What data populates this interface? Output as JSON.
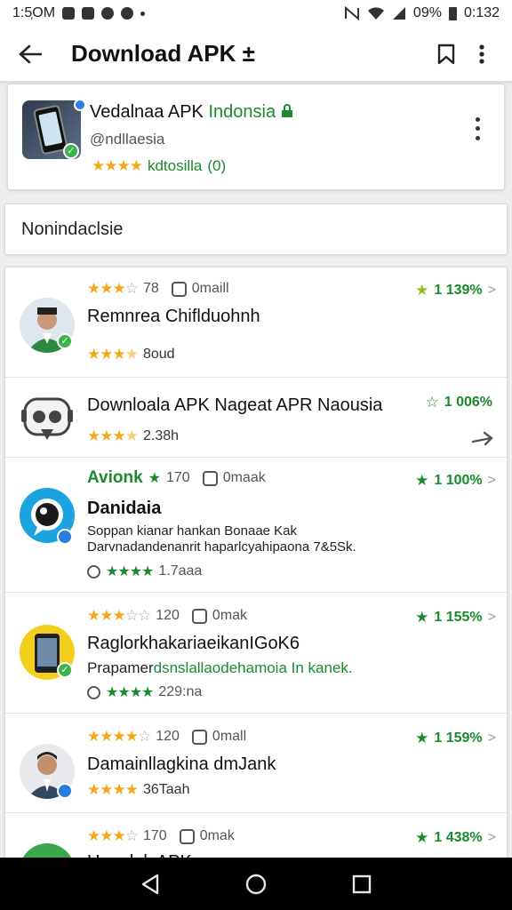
{
  "status_bar": {
    "time": "1:5᷊OM",
    "battery": "09%",
    "clock": "0:132"
  },
  "app_bar": {
    "title": "Download APK ±"
  },
  "top_card": {
    "name_main": "Vedalnaa APK ",
    "name_highlight": "Indonsia",
    "subtitle": "@ndllaesia",
    "stars": "★★★★",
    "rating_label": "kdtosilla",
    "rating_badge": "(0)"
  },
  "search": {
    "placeholder": "Nonindaclsie"
  },
  "list": [
    {
      "meta_stars": "★★★",
      "meta_empty": "☆",
      "meta_num": "78",
      "meta_label": "0maill",
      "pct": "1 139%",
      "title": "Remnrea Chiflduohnh",
      "stars": "★★★",
      "stars_empty": "★",
      "rating_text": "8oud"
    },
    {
      "title": "Downloala APK Nageat APR Naousia",
      "pct": "1 006%",
      "stars": "★★★",
      "stars_empty": "★",
      "rating_text": "2.38h"
    },
    {
      "meta_title": "Avionk",
      "meta_num": "170",
      "meta_label": "0maak",
      "pct": "1 100%",
      "title": "Danidaia",
      "desc_1": "Soppan kianar hankan Bonaae Kak",
      "desc_2": "Darvnadandenanrit haparlcyahipaona 7&5Sk.",
      "stars": "★★★★",
      "rating_text": "1.7aaa"
    },
    {
      "meta_stars": "★★★",
      "meta_empty": "☆☆",
      "meta_num": "120",
      "meta_label": "0mak",
      "pct": "1 155%",
      "title": "RaglorkhakariaeikanIGoK6",
      "desc_1_black": "Prapamer",
      "desc_1_green": "dsnslallaodehamoia In kanek.",
      "stars": "★★★★",
      "rating_text": "229:na"
    },
    {
      "meta_stars": "★★★★",
      "meta_empty": "☆",
      "meta_num": "120",
      "meta_label": "0mall",
      "pct": "1 159%",
      "title": "Damainllagkina dmJank",
      "stars": "★★★★",
      "rating_text": "36Taah"
    },
    {
      "meta_stars": "★★★",
      "meta_empty": "☆",
      "meta_num": "170",
      "meta_label": "0mak",
      "pct": "1 438%",
      "title": "Hanulak APK"
    }
  ],
  "colors": {
    "accent_green": "#1a8a2e",
    "star_gold": "#f2a81a",
    "badge_blue": "#2a7de1"
  },
  "icons": [
    "back-arrow-icon",
    "bookmark-icon",
    "more-vert-icon",
    "chevron-right-icon",
    "arrow-right-icon",
    "nav-back-icon",
    "nav-home-icon",
    "nav-recents-icon"
  ]
}
